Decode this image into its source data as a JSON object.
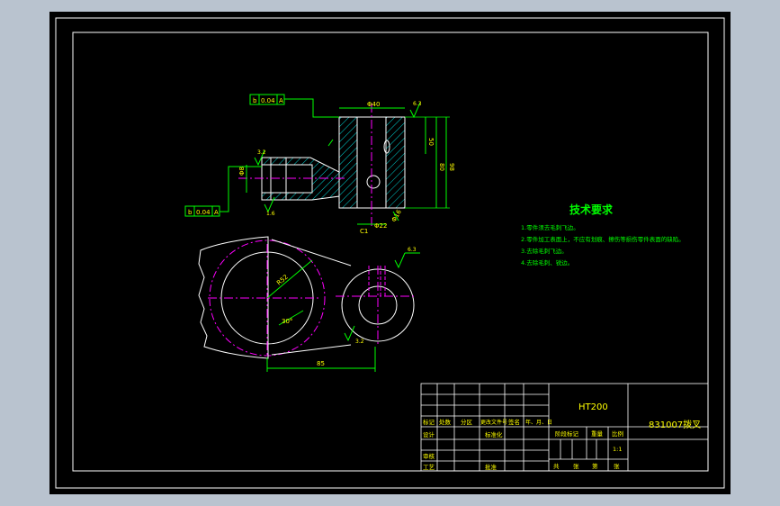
{
  "drawing": {
    "title": "技术要求",
    "requirements": [
      "1.零件须去毛刺飞边。",
      "2.零件加工表面上，不应有划痕、擦伤等损伤零件表面的缺陷。",
      "3.去除毛刺飞边。",
      "4.去除毛刺、锐边。"
    ],
    "dims": {
      "bore": "Φ40",
      "h50": "50",
      "h80": "80",
      "h98": "98",
      "small_d": "Φ22",
      "r_big": "R52",
      "chamfer": "C1",
      "span": "85",
      "angle": "30°",
      "slot": "Φ8",
      "hole": "Φ16"
    },
    "tolerance_frames": [
      {
        "sym": "b",
        "val": "0.04",
        "ref": "A"
      },
      {
        "sym": "b",
        "val": "0.04",
        "ref": "A"
      }
    ],
    "roughness": [
      "6.3",
      "3.2",
      "1.6"
    ],
    "datum": "A"
  },
  "title_block": {
    "material": "HT200",
    "part_name": "831007拨叉",
    "headers": [
      "标记",
      "处数",
      "分区",
      "更改文件号",
      "签名",
      "年、月、日"
    ],
    "row_design": [
      "设计",
      "标准化"
    ],
    "row_check": "审核",
    "row_process": "工艺",
    "row_approve": "批准",
    "stage_label": "阶段标记",
    "weight_label": "重量",
    "scale_label": "比例",
    "scale_value": "1:1",
    "sheets": [
      "共",
      "张",
      "第",
      "张"
    ]
  },
  "colors": {
    "background": "#000000",
    "frame": "#ffffff",
    "geometry": "#ffffff",
    "dimension": "#00ff00",
    "centerline": "#ff00ff",
    "hatch": "#00ffff",
    "text": "#ffff00"
  }
}
